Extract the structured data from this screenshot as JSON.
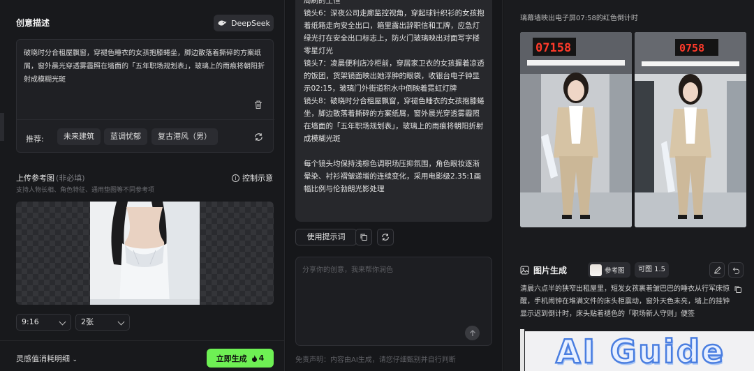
{
  "left": {
    "section_title": "创意描述",
    "deepseek_label": "DeepSeek",
    "description": "破晓时分合租屋飘窗，穿褪色睡衣的女孩抱膝蜷坐，脚边散落着撕碎的方案纸屑，窗外晨光穿透雾霾照在墙面的「五年职场规划表」，玻璃上的雨痕将朝阳折射成模糊光斑",
    "rec_label": "推荐:",
    "chips": [
      "未来建筑",
      "蓝调忧郁",
      "复古港风（男）"
    ],
    "upload_title": "上传参考图",
    "upload_optional": "(非必填)",
    "upload_sub": "支持人物长相、角色特征、通用垫图等不同参考项",
    "control_hint": "控制示意",
    "ratio_value": "9:16",
    "count_value": "2张",
    "cost_label": "灵感值消耗明细",
    "generate_label": "立即生成",
    "generate_cost": "4"
  },
  "mid": {
    "paragraphs": [
      "局刷的土恒",
      "镜头6：深夜公司走廊监控视角，穿起球针织衫的女孩抱着纸箱走向安全出口，箱里露出辞职信和工牌，应急灯绿光打在安全出口标志上，防火门玻璃映出对面写字楼零星灯光",
      "镜头7：凌晨便利店冷柜前，穿居家卫衣的女孩握着凉透的饭团，货架镜面映出她浮肿的眼袋，收银台电子钟显示02:15，玻璃门外街道积水中倒映着霓虹灯牌",
      "镜头8：破晓时分合租屋飘窗，穿褪色睡衣的女孩抱膝蜷坐，脚边散落着撕碎的方案纸屑，窗外晨光穿透雾霾照在墙面的「五年职场规划表」，玻璃上的雨痕将朝阳折射成模糊光斑",
      "每个镜头均保持浅棕色调职场压抑氛围，角色眼妆逐渐晕染、衬衫褶皱递增的连续变化，采用电影级2.35:1画幅比例与伦勃朗光影处理"
    ],
    "use_prompt_label": "使用提示词",
    "input_placeholder": "分享你的创意，我来帮你润色",
    "disclaimer": "免责声明：内容由AI生成，请您仔细甄别并自行判断"
  },
  "right": {
    "top_caption": "璃幕墙映出电子屏07:58的红色倒计时",
    "clock_left": "07158",
    "clock_right": "0758",
    "image_gen_title": "图片生成",
    "ref_chip_label": "参考图",
    "ratio_chip_label": "可图 1.5",
    "prompt_text": "清晨六点半的狭窄出租屋里，短发女孩裹着皱巴巴的睡衣从行军床惊醒，手机闹钟在堆满文件的床头柜震动，窗外天色未亮，墙上的挂钟显示迟到倒计时，床头贴着褪色的「职场新人守则」便签",
    "watermark": "AI Guide"
  },
  "colors": {
    "accent_green": "#6ef054",
    "panel_bg": "#18191c",
    "bubble_bg": "#27282c"
  }
}
